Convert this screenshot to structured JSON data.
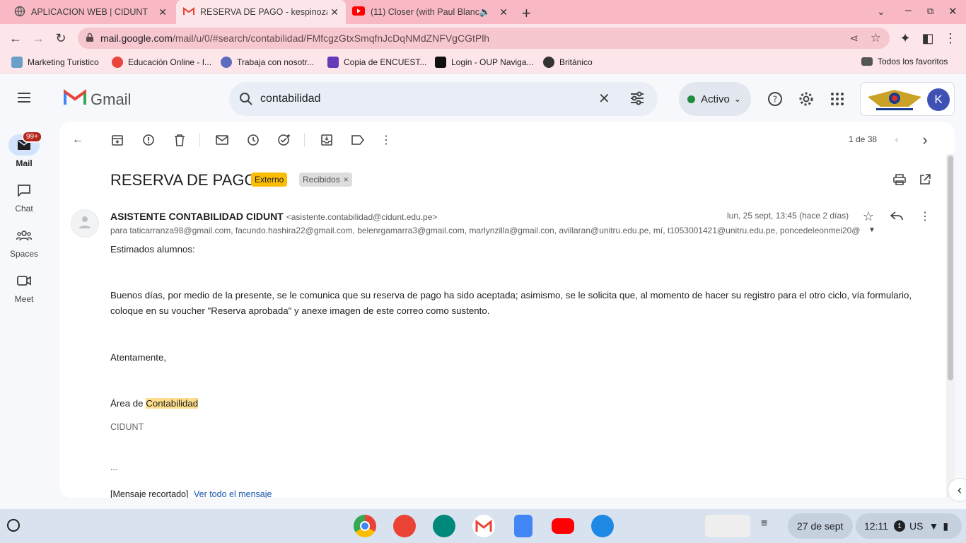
{
  "browser": {
    "tabs": [
      {
        "title": "APLICACION WEB | CIDUNT"
      },
      {
        "title": "RESERVA DE PAGO - kespinozab"
      },
      {
        "title": "(11) Closer (with Paul Blanc"
      }
    ],
    "new_tab": "+",
    "url_host": "mail.google.com",
    "url_path": "/mail/u/0/#search/contabilidad/FMfcgzGtxSmqfnJcDqNMdZNFVgCGtPlh",
    "bookmarks": [
      {
        "label": "Marketing Turistico",
        "color": "#6aa0c8"
      },
      {
        "label": "Educación Online - I...",
        "color": "#e8453c"
      },
      {
        "label": "Trabaja con nosotr...",
        "color": "#5c6bc0"
      },
      {
        "label": "Copia de ENCUEST...",
        "color": "#673ab7"
      },
      {
        "label": "Login - OUP Naviga...",
        "color": "#111111"
      },
      {
        "label": "Británico",
        "color": "#333333"
      }
    ],
    "all_favorites": "Todos los favoritos"
  },
  "gmail": {
    "logo_text": "Gmail",
    "search_value": "contabilidad",
    "status": "Activo",
    "avatar_letter": "K",
    "rail": [
      {
        "label": "Mail",
        "badge": "99+"
      },
      {
        "label": "Chat"
      },
      {
        "label": "Spaces"
      },
      {
        "label": "Meet"
      }
    ],
    "pager": "1 de 38",
    "subject": "RESERVA DE PAGO",
    "chip_external": "Externo",
    "chip_inbox": "Recibidos",
    "chip_inbox_close": "×",
    "sender_name": "ASISTENTE CONTABILIDAD CIDUNT",
    "sender_email": "<asistente.contabilidad@cidunt.edu.pe>",
    "recipients": "para taticarranza98@gmail.com, facundo.hashira22@gmail.com, belenrgamarra3@gmail.com, marlynzilla@gmail.con, avillaran@unitru.edu.pe, mí, t1053001421@unitru.edu.pe, poncedeleonmei20@",
    "date": "lun, 25 sept, 13:45 (hace 2 días)",
    "greeting": "Estimados alumnos:",
    "paragraph": "Buenos días, por medio de la presente, se le comunica que su reserva de pago ha sido aceptada; asimismo, se le solicita que, al momento de hacer su registro para el otro ciclo, vía formulario, coloque en su voucher \"Reserva aprobada\" y anexe imagen de este correo como sustento.",
    "closing": "Atentamente,",
    "sign_prefix": "Área de ",
    "sign_highlight": "Contabilidad",
    "org": "CIDUNT",
    "ellipsis": "...",
    "clipped": "[Mensaje recortado]",
    "view_all": "Ver todo el mensaje"
  },
  "shelf": {
    "date": "27 de sept",
    "time": "12:11",
    "notif_count": "1",
    "locale": "US"
  }
}
